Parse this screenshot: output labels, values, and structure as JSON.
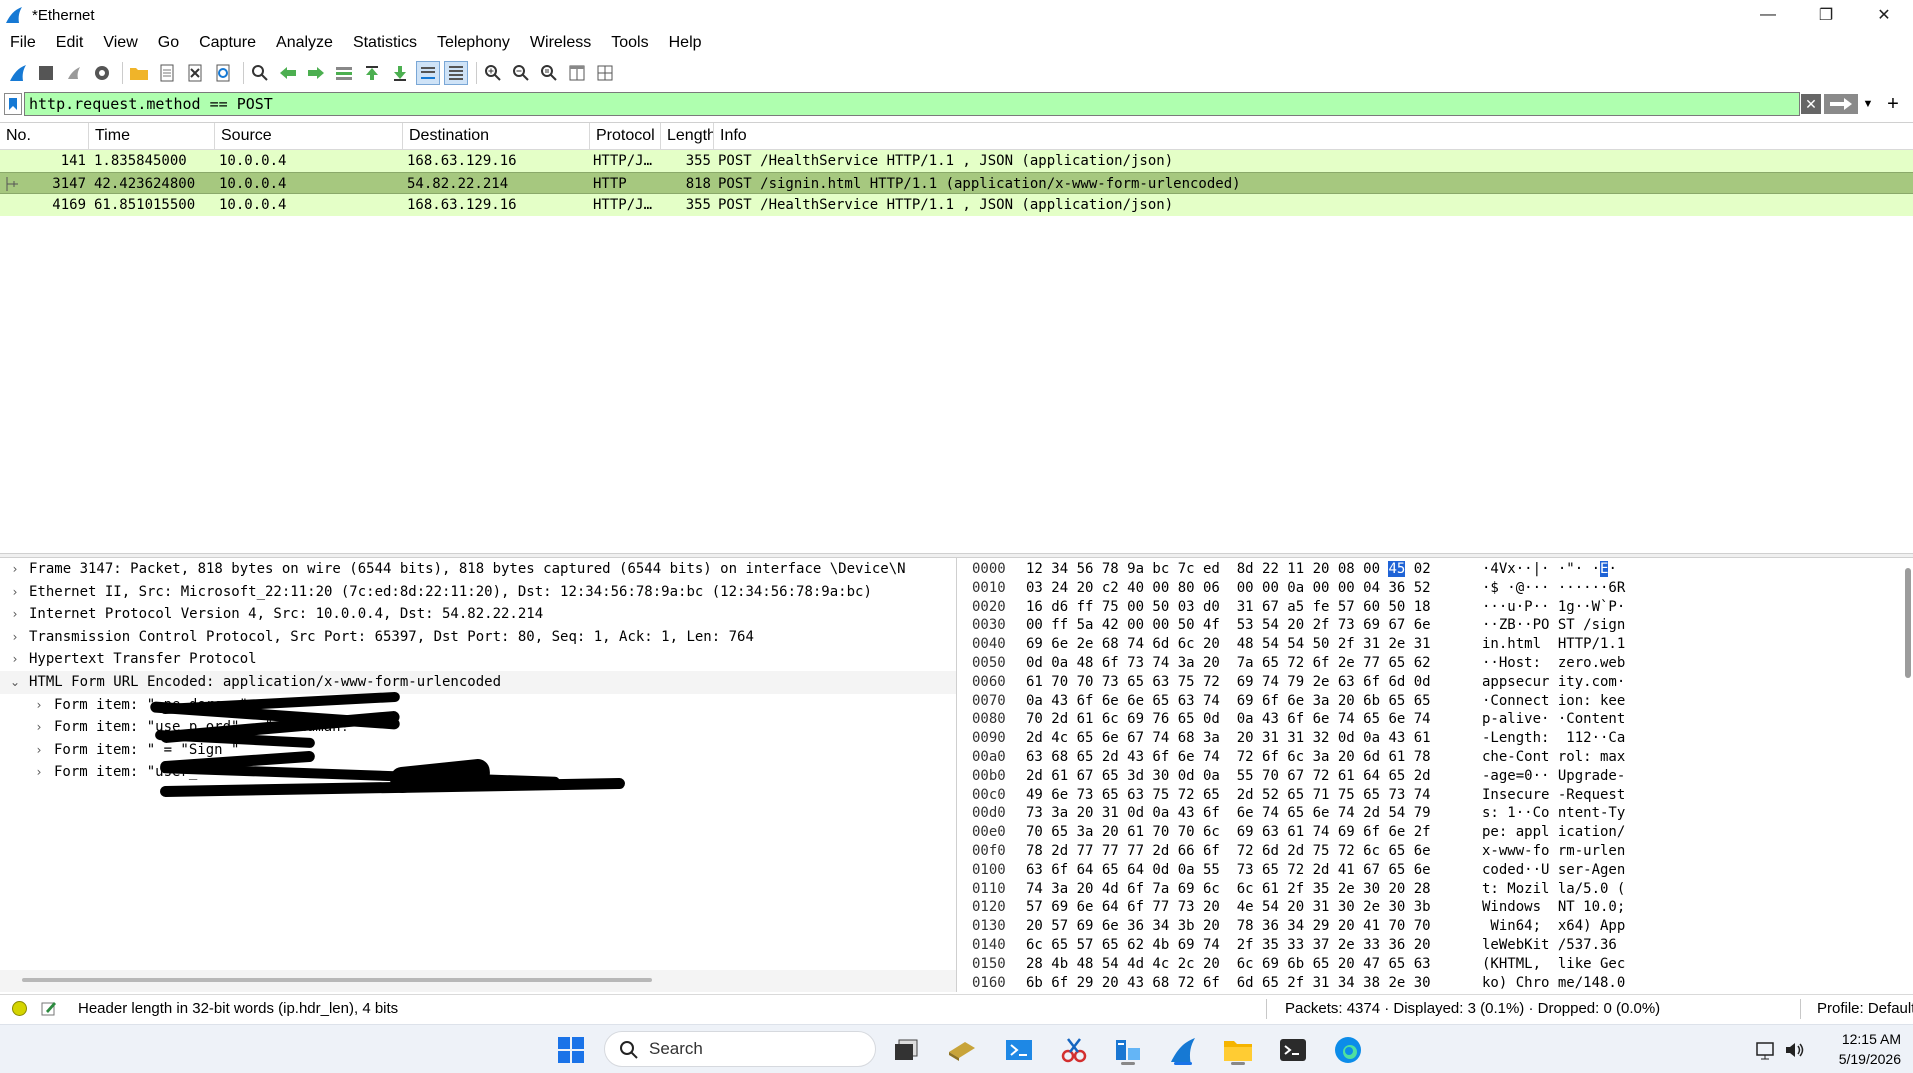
{
  "window": {
    "title": "*Ethernet",
    "minimize": "—",
    "maximize": "❐",
    "close": "✕"
  },
  "menu": [
    "File",
    "Edit",
    "View",
    "Go",
    "Capture",
    "Analyze",
    "Statistics",
    "Telephony",
    "Wireless",
    "Tools",
    "Help"
  ],
  "filter": {
    "value": "http.request.method == POST",
    "plus": "+"
  },
  "packet_list": {
    "columns": [
      "No.",
      "Time",
      "Source",
      "Destination",
      "Protocol",
      "Length",
      "Info"
    ],
    "rows": [
      {
        "no": "141",
        "time": "1.835845000",
        "source": "10.0.0.4",
        "destination": "168.63.129.16",
        "protocol": "HTTP/J…",
        "length": "355",
        "info": "POST /HealthService HTTP/1.1 , JSON (application/json)"
      },
      {
        "no": "3147",
        "time": "42.423624800",
        "source": "10.0.0.4",
        "destination": "54.82.22.214",
        "protocol": "HTTP",
        "length": "818",
        "info": "POST /signin.html HTTP/1.1  (application/x-www-form-urlencoded)"
      },
      {
        "no": "4169",
        "time": "61.851015500",
        "source": "10.0.0.4",
        "destination": "168.63.129.16",
        "protocol": "HTTP/J…",
        "length": "355",
        "info": "POST /HealthService HTTP/1.1 , JSON (application/json)"
      }
    ]
  },
  "details": {
    "rows": [
      {
        "text": "Frame 3147: Packet, 818 bytes on wire (6544 bits), 818 bytes captured (6544 bits) on interface \\Device\\N",
        "indent": 0,
        "expanded": false
      },
      {
        "text": "Ethernet II, Src: Microsoft_22:11:20 (7c:ed:8d:22:11:20), Dst: 12:34:56:78:9a:bc (12:34:56:78:9a:bc)",
        "indent": 0,
        "expanded": false
      },
      {
        "text": "Internet Protocol Version 4, Src: 10.0.0.4, Dst: 54.82.22.214",
        "indent": 0,
        "expanded": false
      },
      {
        "text": "Transmission Control Protocol, Src Port: 65397, Dst Port: 80, Seq: 1, Ack: 1, Len: 764",
        "indent": 0,
        "expanded": false
      },
      {
        "text": "Hypertext Transfer Protocol",
        "indent": 0,
        "expanded": false
      },
      {
        "text": "HTML Form URL Encoded: application/x-www-form-urlencoded",
        "indent": 0,
        "expanded": true
      },
      {
        "text": "Form item: \"                        pe.derson\"",
        "indent": 1,
        "expanded": false
      },
      {
        "text": "Form item: \"use    p     ord\" = \"    echaman!\"",
        "indent": 1,
        "expanded": false
      },
      {
        "text": "Form item: \"          = \"Sign    \"",
        "indent": 1,
        "expanded": false
      },
      {
        "text": "Form item: \"user_        \"",
        "indent": 1,
        "expanded": false
      }
    ]
  },
  "bytes": {
    "rows": [
      {
        "off": "0000",
        "hex1": "12 34 56 78 9a bc 7c ed",
        "hex2": "8d 22 11 20 08 00",
        "hexhl": "45",
        "hex3": "02",
        "asc1": "·4Vx··|· ·\"· ·",
        "aschl": "E",
        "asc2": "·"
      },
      {
        "off": "0010",
        "hex1": "03 24 20 c2 40 00 80 06",
        "hex2": "00 00 0a 00 00 04 36 52",
        "asc1": "·$ ·@··· ······6R"
      },
      {
        "off": "0020",
        "hex1": "16 d6 ff 75 00 50 03 d0",
        "hex2": "31 67 a5 fe 57 60 50 18",
        "asc1": "···u·P·· 1g··W`P·"
      },
      {
        "off": "0030",
        "hex1": "00 ff 5a 42 00 00 50 4f",
        "hex2": "53 54 20 2f 73 69 67 6e",
        "asc1": "··ZB··PO ST /sign"
      },
      {
        "off": "0040",
        "hex1": "69 6e 2e 68 74 6d 6c 20",
        "hex2": "48 54 54 50 2f 31 2e 31",
        "asc1": "in.html  HTTP/1.1"
      },
      {
        "off": "0050",
        "hex1": "0d 0a 48 6f 73 74 3a 20",
        "hex2": "7a 65 72 6f 2e 77 65 62",
        "asc1": "··Host:  zero.web"
      },
      {
        "off": "0060",
        "hex1": "61 70 70 73 65 63 75 72",
        "hex2": "69 74 79 2e 63 6f 6d 0d",
        "asc1": "appsecur ity.com·"
      },
      {
        "off": "0070",
        "hex1": "0a 43 6f 6e 6e 65 63 74",
        "hex2": "69 6f 6e 3a 20 6b 65 65",
        "asc1": "·Connect ion: kee"
      },
      {
        "off": "0080",
        "hex1": "70 2d 61 6c 69 76 65 0d",
        "hex2": "0a 43 6f 6e 74 65 6e 74",
        "asc1": "p-alive· ·Content"
      },
      {
        "off": "0090",
        "hex1": "2d 4c 65 6e 67 74 68 3a",
        "hex2": "20 31 31 32 0d 0a 43 61",
        "asc1": "-Length:  112··Ca"
      },
      {
        "off": "00a0",
        "hex1": "63 68 65 2d 43 6f 6e 74",
        "hex2": "72 6f 6c 3a 20 6d 61 78",
        "asc1": "che-Cont rol: max"
      },
      {
        "off": "00b0",
        "hex1": "2d 61 67 65 3d 30 0d 0a",
        "hex2": "55 70 67 72 61 64 65 2d",
        "asc1": "-age=0·· Upgrade-"
      },
      {
        "off": "00c0",
        "hex1": "49 6e 73 65 63 75 72 65",
        "hex2": "2d 52 65 71 75 65 73 74",
        "asc1": "Insecure -Request"
      },
      {
        "off": "00d0",
        "hex1": "73 3a 20 31 0d 0a 43 6f",
        "hex2": "6e 74 65 6e 74 2d 54 79",
        "asc1": "s: 1··Co ntent-Ty"
      },
      {
        "off": "00e0",
        "hex1": "70 65 3a 20 61 70 70 6c",
        "hex2": "69 63 61 74 69 6f 6e 2f",
        "asc1": "pe: appl ication/"
      },
      {
        "off": "00f0",
        "hex1": "78 2d 77 77 77 2d 66 6f",
        "hex2": "72 6d 2d 75 72 6c 65 6e",
        "asc1": "x-www-fo rm-urlen"
      },
      {
        "off": "0100",
        "hex1": "63 6f 64 65 64 0d 0a 55",
        "hex2": "73 65 72 2d 41 67 65 6e",
        "asc1": "coded··U ser-Agen"
      },
      {
        "off": "0110",
        "hex1": "74 3a 20 4d 6f 7a 69 6c",
        "hex2": "6c 61 2f 35 2e 30 20 28",
        "asc1": "t: Mozil la/5.0 ("
      },
      {
        "off": "0120",
        "hex1": "57 69 6e 64 6f 77 73 20",
        "hex2": "4e 54 20 31 30 2e 30 3b",
        "asc1": "Windows  NT 10.0;"
      },
      {
        "off": "0130",
        "hex1": "20 57 69 6e 36 34 3b 20",
        "hex2": "78 36 34 29 20 41 70 70",
        "asc1": " Win64;  x64) App"
      },
      {
        "off": "0140",
        "hex1": "6c 65 57 65 62 4b 69 74",
        "hex2": "2f 35 33 37 2e 33 36 20",
        "asc1": "leWebKit /537.36 "
      },
      {
        "off": "0150",
        "hex1": "28 4b 48 54 4d 4c 2c 20",
        "hex2": "6c 69 6b 65 20 47 65 63",
        "asc1": "(KHTML,  like Gec"
      },
      {
        "off": "0160",
        "hex1": "6b 6f 29 20 43 68 72 6f",
        "hex2": "6d 65 2f 31 34 38 2e 30",
        "asc1": "ko) Chro me/148.0"
      }
    ]
  },
  "status": {
    "field_info": "Header length in 32-bit words (ip.hdr_len), 4 bits",
    "packets": "Packets: 4374 · Displayed: 3 (0.1%) · Dropped: 0 (0.0%)",
    "profile": "Profile: Default"
  },
  "taskbar": {
    "search_label": "Search",
    "time": "12:15 AM",
    "date": "5/19/2026"
  },
  "colors": {
    "filter_valid_bg": "#afffaf",
    "http_row_bg": "#e4ffc7",
    "selected_row_bg": "#a6c87f",
    "byte_highlight": "#1f63d6",
    "wireshark_blue": "#1679d4"
  }
}
